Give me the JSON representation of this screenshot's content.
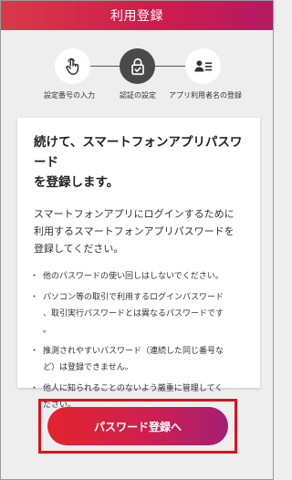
{
  "header": {
    "title": "利用登録"
  },
  "colors": {
    "accent_start": "#e3242c",
    "accent_end": "#a51f72",
    "active_step": "#4a4a4a"
  },
  "steps": [
    {
      "label": "設定番号の入力",
      "icon": "hand-tap-icon",
      "state": "done"
    },
    {
      "label": "認証の設定",
      "icon": "lock-check-icon",
      "state": "active"
    },
    {
      "label": "アプリ利用者名の登録",
      "icon": "user-id-icon",
      "state": "pending"
    }
  ],
  "card": {
    "heading_line1": "続けて、スマートフォンアプリパスワード",
    "heading_line2": "を登録します。",
    "intro_line1": "スマートフォンアプリにログインするために",
    "intro_line2": "利用するスマートフォンアプリパスワードを",
    "intro_line3": "登録してください。",
    "notes": [
      {
        "line1": "他のパスワードの使い回しはしないでください。",
        "line2": ""
      },
      {
        "line1": "パソコン等の取引で利用するログインパスワード",
        "line2": "、取引実行パスワードとは異なるパスワードです",
        "line3": "。"
      },
      {
        "line1": "推測されやすいパスワード（連続した同じ番号な",
        "line2": "ど）は登録できません。"
      },
      {
        "line1": "他人に知られることのないよう厳重に管理してく",
        "line2": "ださい。"
      }
    ]
  },
  "cta": {
    "label": "パスワード登録へ"
  }
}
